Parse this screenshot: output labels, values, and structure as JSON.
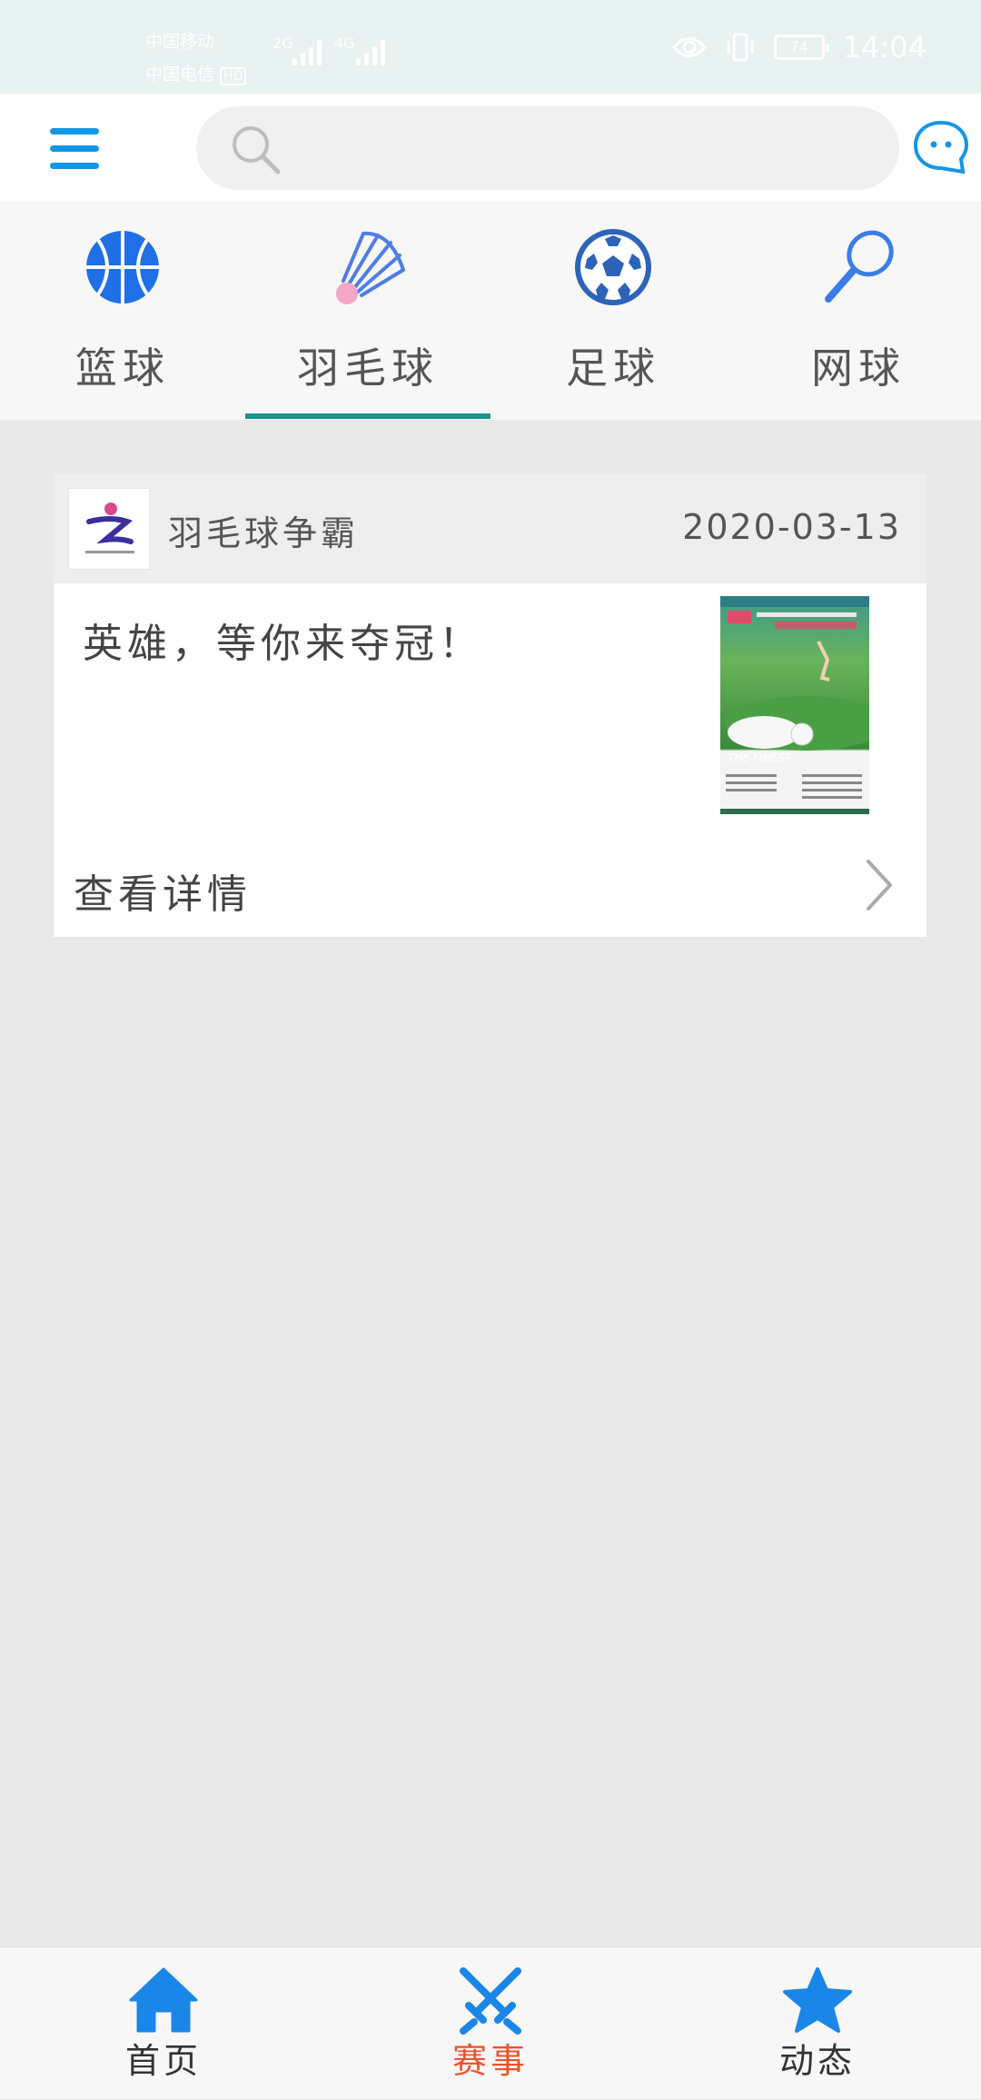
{
  "status_bar": {
    "carrier_1": "中国移动",
    "carrier_2": "中国电信",
    "hd_badge": "HD",
    "net_1": "2G",
    "net_2": "4G",
    "battery": "74",
    "time": "14:04"
  },
  "search": {
    "placeholder": ""
  },
  "categories": [
    {
      "label": "篮球",
      "icon": "basketball-icon"
    },
    {
      "label": "羽毛球",
      "icon": "shuttlecock-icon"
    },
    {
      "label": "足球",
      "icon": "soccer-ball-icon"
    },
    {
      "label": "网球",
      "icon": "tennis-racket-icon"
    }
  ],
  "active_category": "羽毛球",
  "card": {
    "org_name": "羽毛球争霸",
    "date": "2020-03-13",
    "title": "英雄，等你来夺冠！",
    "detail_label": "查看详情",
    "poster_text": "THE FINEST"
  },
  "bottom_nav": [
    {
      "label": "首页",
      "icon": "home-icon"
    },
    {
      "label": "赛事",
      "icon": "crossed-swords-icon",
      "active": true
    },
    {
      "label": "动态",
      "icon": "star-icon"
    }
  ],
  "colors": {
    "accent": "#1496e6",
    "tab_underline": "#17968a",
    "active_nav": "#f0522b"
  }
}
